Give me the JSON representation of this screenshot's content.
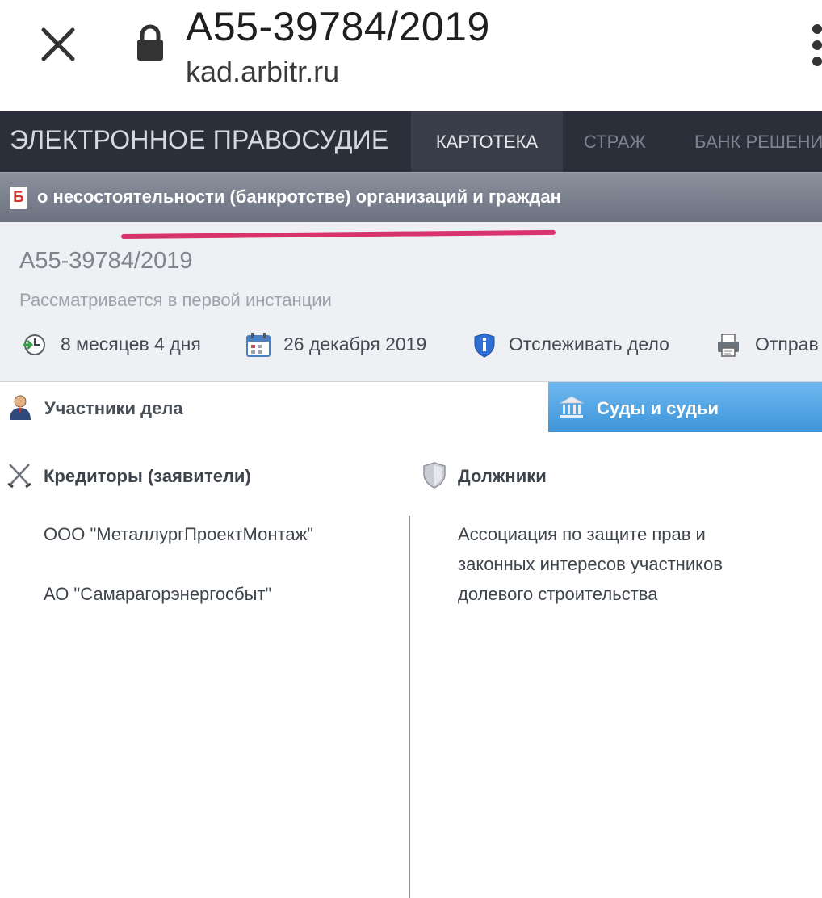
{
  "browser": {
    "title": "А55-39784/2019",
    "domain": "kad.arbitr.ru"
  },
  "nav": {
    "logo": "ЭЛЕКТРОННОЕ ПРАВОСУДИЕ",
    "items": [
      {
        "label": "КАРТОТЕКА",
        "active": true
      },
      {
        "label": "СТРАЖ",
        "active": false
      },
      {
        "label": "БАНК РЕШЕНИ",
        "active": false
      }
    ]
  },
  "category": {
    "badge": "Б",
    "title": "о несостоятельности (банкротстве) организаций и граждан"
  },
  "case": {
    "number": "А55-39784/2019",
    "status": "Рассматривается в первой инстанции",
    "duration": "8 месяцев 4 дня",
    "date": "26 декабря 2019",
    "track": "Отслеживать дело",
    "send": "Отправ"
  },
  "tabs": {
    "participants": "Участники дела",
    "courts": "Суды и судьи"
  },
  "parties": {
    "creditors_header": "Кредиторы (заявители)",
    "creditors": [
      "ООО \"МеталлургПроектМонтаж\"",
      "АО \"Самарагорэнергосбыт\""
    ],
    "debtors_header": "Должники",
    "debtors": [
      "Ассоциация по защите прав и",
      "законных интересов участников",
      "долевого строительства"
    ]
  },
  "colors": {
    "nav_bg": "#2b2f3a",
    "category_bg": "#7a808c",
    "panel_bg": "#eef0f3",
    "accent_tab": "#4a9fe0",
    "highlight_line": "#d8336b"
  }
}
